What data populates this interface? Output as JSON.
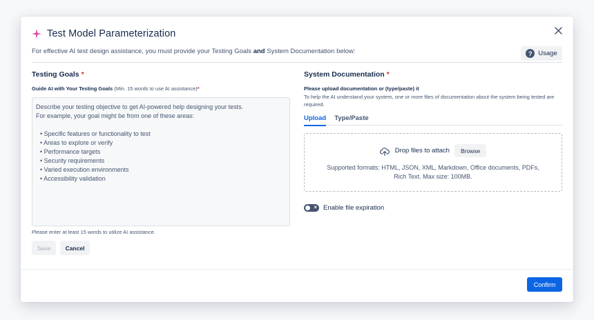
{
  "colors": {
    "accent": "#0c66e4",
    "required": "#c9372c",
    "sparkle": "#e2479c",
    "text": "#172b4d",
    "muted": "#44546f"
  },
  "dialog": {
    "title": "Test Model Parameterization",
    "title_icon": "sparkle-icon",
    "close_icon": "close-icon",
    "intro_before": "For effective AI test design assistance, you must provide your Testing Goals ",
    "intro_bold": "and",
    "intro_after": " System Documentation below:",
    "usage_label": "Usage",
    "usage_icon": "help-icon"
  },
  "testing_goals": {
    "title": "Testing Goals",
    "required_mark": "*",
    "field_label": "Guide AI with Your Testing Goals",
    "field_hint": "(Min. 15 words to use AI assistance)",
    "field_required_mark": "*",
    "placeholder_lines": [
      "Describe your testing objective to get AI-powered help designing your tests.",
      "For example, your goal might be from one of these areas:"
    ],
    "placeholder_bullets": [
      "• Specific features or functionality to test",
      "• Areas to explore or verify",
      "• Performance targets",
      "• Security requirements",
      "• Varied execution environments",
      "• Accessibility validation"
    ],
    "helper_text": "Please enter at least 15 words to utilize AI assistance.",
    "save_label": "Save",
    "cancel_label": "Cancel"
  },
  "system_docs": {
    "title": "System Documentation",
    "required_mark": "*",
    "sub_label": "Please upload documentation or (type/paste) it",
    "description": "To help the AI understand your system, one or more files of documentation about the system being tested are required.",
    "tabs": [
      {
        "label": "Upload",
        "active": true
      },
      {
        "label": "Type/Paste",
        "active": false
      }
    ],
    "drop_icon": "cloud-upload-icon",
    "drop_text": "Drop files to attach",
    "browse_label": "Browse",
    "formats_line1": "Supported formats: HTML, JSON, XML, Markdown, Office documents, PDFs,",
    "formats_line2": "Rich Text. Max size: 100MB.",
    "expiration_toggle_on": false,
    "expiration_label": "Enable file expiration"
  },
  "footer": {
    "confirm_label": "Confirm"
  }
}
